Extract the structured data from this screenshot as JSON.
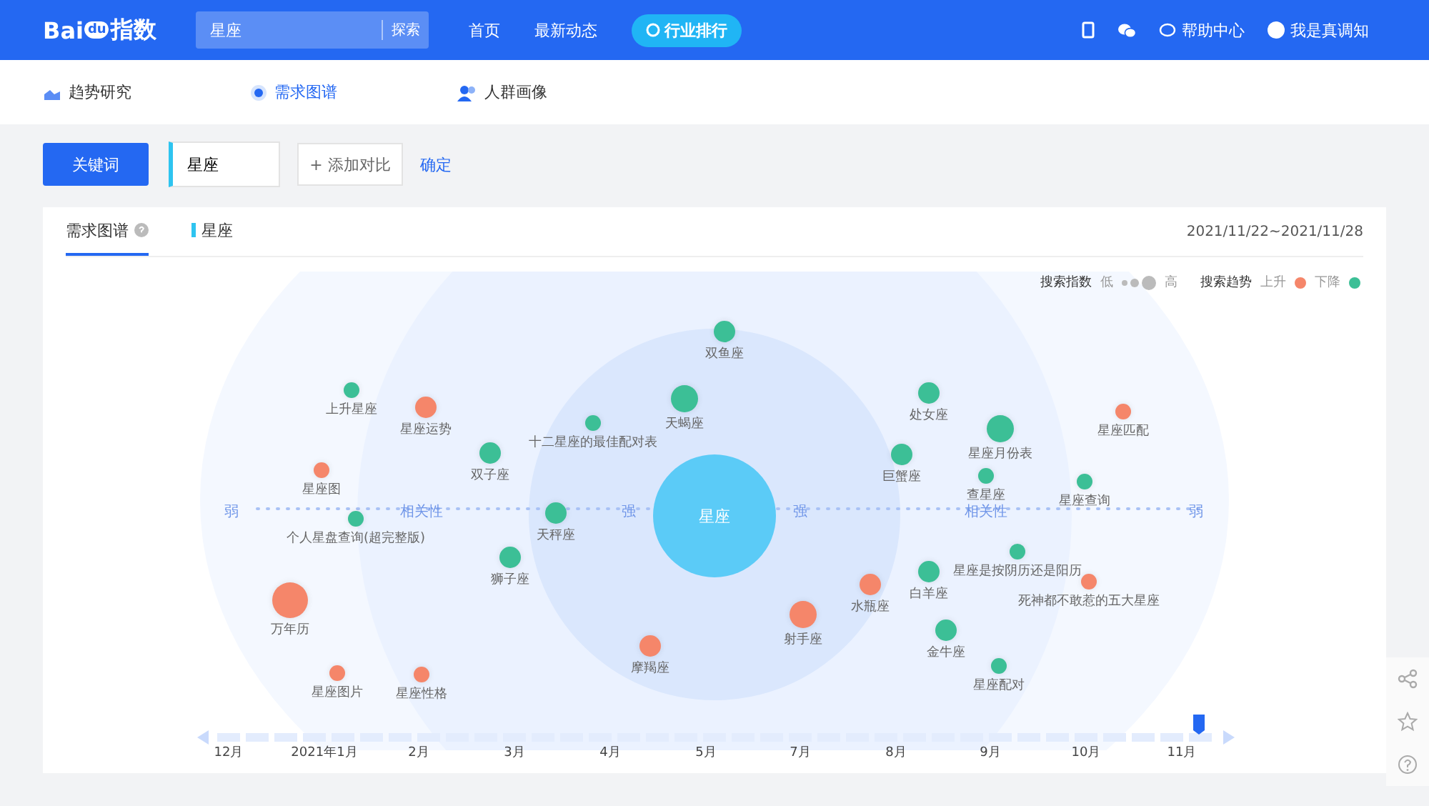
{
  "header": {
    "logo": {
      "latin": "Bai",
      "paw": "du",
      "name": "指数"
    },
    "search": {
      "value": "星座",
      "button": "探索"
    },
    "nav": [
      {
        "label": "首页",
        "kind": "link"
      },
      {
        "label": "最新动态",
        "kind": "link"
      },
      {
        "label": "行业排行",
        "kind": "pill"
      }
    ],
    "help": "帮助中心",
    "user": "我是真调知"
  },
  "subnav": [
    {
      "label": "趋势研究",
      "selected": false,
      "kind": "chart"
    },
    {
      "label": "需求图谱",
      "selected": true,
      "kind": "radar"
    },
    {
      "label": "人群画像",
      "selected": false,
      "kind": "people"
    }
  ],
  "query": {
    "button": "关键词",
    "keyword": "星座",
    "add": "+ 添加对比",
    "confirm": "确定"
  },
  "card": {
    "tabs": [
      {
        "label": "需求图谱",
        "selected": true,
        "help": true
      },
      {
        "label": "星座",
        "selected": false,
        "help": false
      }
    ],
    "date": "2021/11/22~2021/11/28",
    "legend": {
      "index_label": "搜索指数",
      "low": "低",
      "high": "高",
      "trend_label": "搜索趋势",
      "up": "上升",
      "down": "下降"
    },
    "axis": {
      "left": [
        "弱",
        "相关性",
        "强"
      ],
      "right": [
        "强",
        "相关性",
        "弱"
      ]
    },
    "center": "星座",
    "nodes": [
      {
        "label": "双鱼座",
        "color": "#3cbf96",
        "kind": "medium"
      },
      {
        "label": "上升星座",
        "color": "#3cbf96",
        "kind": "small"
      },
      {
        "label": "星座运势",
        "color": "#f5866a",
        "kind": "medium"
      },
      {
        "label": "天蝎座",
        "color": "#3cbf96",
        "kind": "large"
      },
      {
        "label": "处女座",
        "color": "#3cbf96",
        "kind": "medium"
      },
      {
        "label": "星座匹配",
        "color": "#f5866a",
        "kind": "small"
      },
      {
        "label": "双子座",
        "color": "#3cbf96",
        "kind": "medium"
      },
      {
        "label": "十二星座的最佳配对表",
        "color": "#3cbf96",
        "kind": "small"
      },
      {
        "label": "巨蟹座",
        "color": "#3cbf96",
        "kind": "medium"
      },
      {
        "label": "星座月份表",
        "color": "#3cbf96",
        "kind": "large"
      },
      {
        "label": "星座图",
        "color": "#f5866a",
        "kind": "small"
      },
      {
        "label": "查星座",
        "color": "#3cbf96",
        "kind": "small"
      },
      {
        "label": "星座查询",
        "color": "#3cbf96",
        "kind": "small"
      },
      {
        "label": "个人星盘查询(超完整版)",
        "color": "#3cbf96",
        "kind": "small"
      },
      {
        "label": "天秤座",
        "color": "#3cbf96",
        "kind": "medium"
      },
      {
        "label": "狮子座",
        "color": "#3cbf96",
        "kind": "medium"
      },
      {
        "label": "万年历",
        "color": "#f5866a",
        "kind": "huge"
      },
      {
        "label": "白羊座",
        "color": "#3cbf96",
        "kind": "medium"
      },
      {
        "label": "星座是按阴历还是阳历",
        "color": "#3cbf96",
        "kind": "small"
      },
      {
        "label": "死神都不敢惹的五大星座",
        "color": "#f5866a",
        "kind": "small"
      },
      {
        "label": "水瓶座",
        "color": "#f5866a",
        "kind": "medium"
      },
      {
        "label": "射手座",
        "color": "#f5866a",
        "kind": "large"
      },
      {
        "label": "摩羯座",
        "color": "#f5866a",
        "kind": "medium"
      },
      {
        "label": "金牛座",
        "color": "#3cbf96",
        "kind": "medium"
      },
      {
        "label": "星座图片",
        "color": "#f5866a",
        "kind": "small"
      },
      {
        "label": "星座性格",
        "color": "#f5866a",
        "kind": "small"
      },
      {
        "label": "星座配对",
        "color": "#3cbf96",
        "kind": "small"
      }
    ],
    "timeline": {
      "months": [
        "12月",
        "2021年1月",
        "2月",
        "3月",
        "4月",
        "5月",
        "7月",
        "8月",
        "9月",
        "10月",
        "11月"
      ]
    }
  }
}
